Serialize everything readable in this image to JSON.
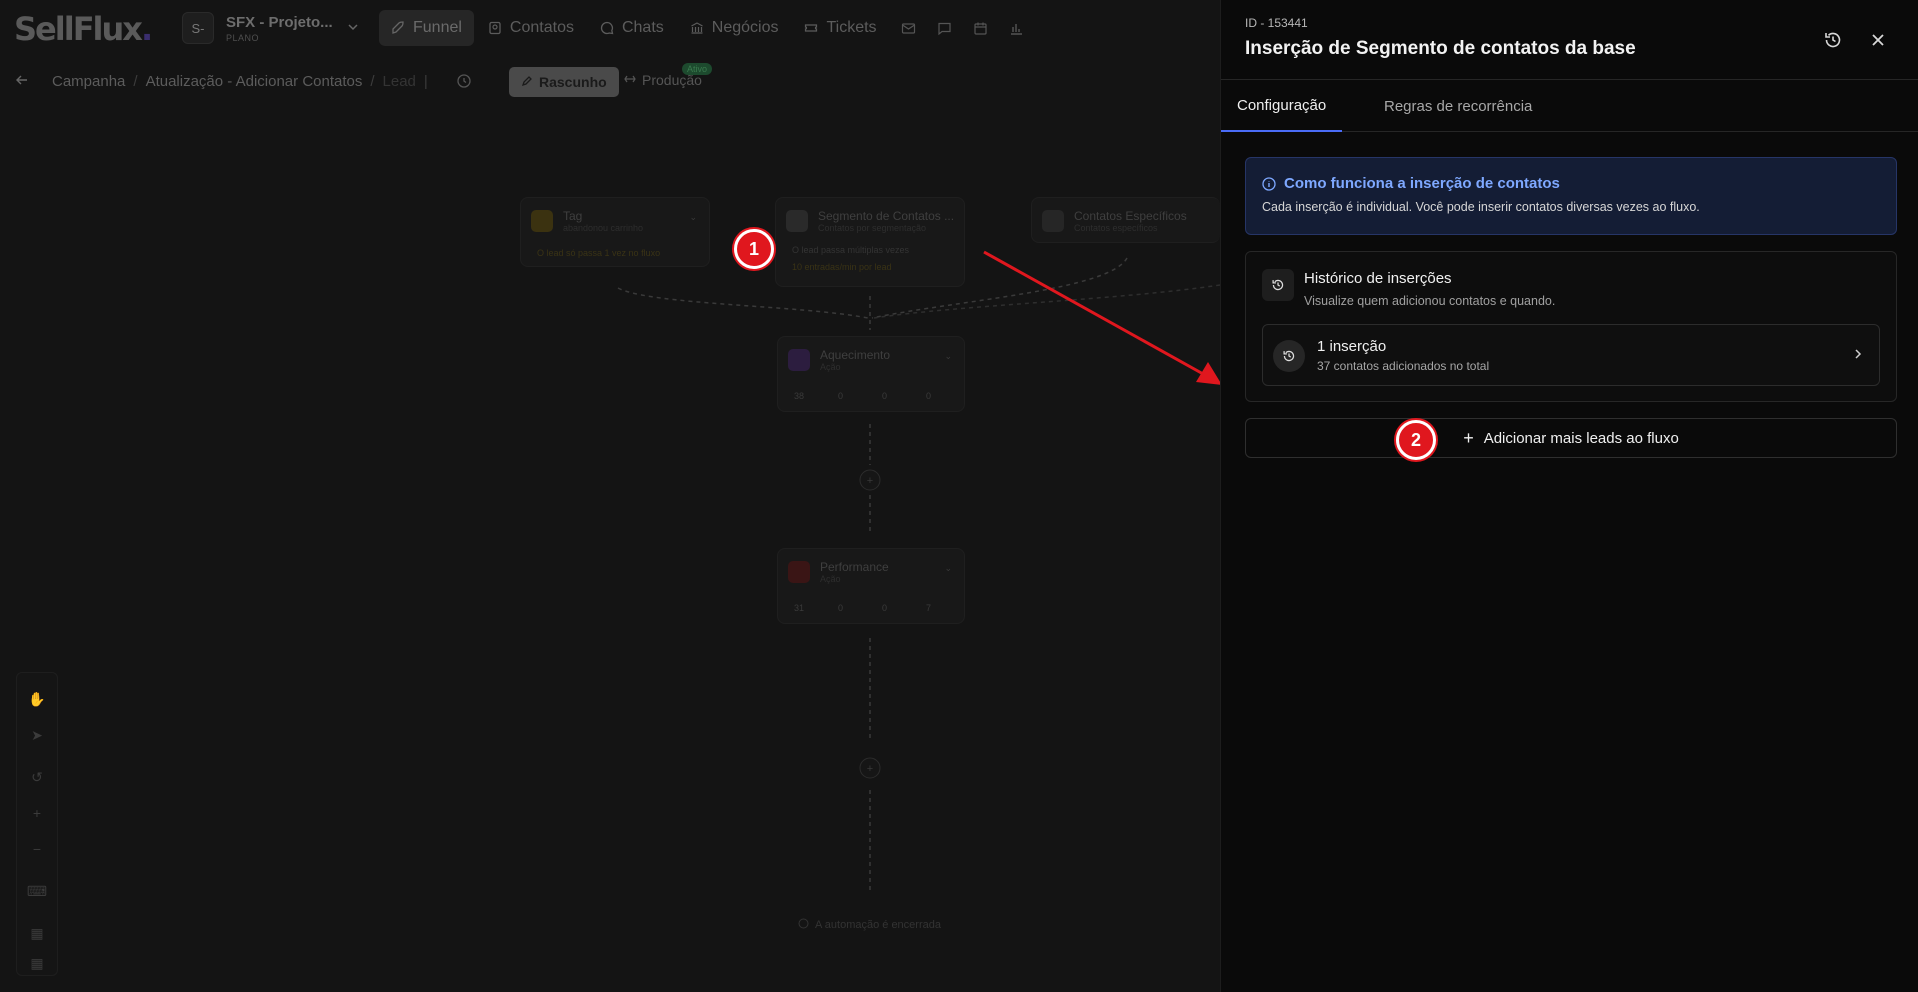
{
  "app": {
    "logo_text": "SellFlux",
    "project": {
      "avatar": "S-",
      "name": "SFX - Projeto...",
      "plan": "PLANO"
    }
  },
  "nav": {
    "items": [
      {
        "label": "Funnel",
        "icon": "rocket-icon",
        "active": true
      },
      {
        "label": "Contatos",
        "icon": "contacts-icon"
      },
      {
        "label": "Chats",
        "icon": "chat-bubble-icon"
      },
      {
        "label": "Negócios",
        "icon": "bank-icon"
      },
      {
        "label": "Tickets",
        "icon": "ticket-icon"
      }
    ],
    "icon_buttons": [
      "mail-icon",
      "message-square-icon",
      "calendar-icon",
      "bar-chart-icon"
    ]
  },
  "breadcrumb": {
    "items": [
      "Campanha",
      "Atualização - Adicionar Contatos",
      "Lead"
    ],
    "draft_label": "Rascunho",
    "production_label": "Produção",
    "active_badge": "Ativo"
  },
  "canvas": {
    "nodes": {
      "tag": {
        "title": "Tag",
        "subtitle": "abandonou carrinho",
        "line1": "O lead só passa 1 vez no fluxo"
      },
      "segment": {
        "title": "Segmento de Contatos ...",
        "subtitle": "Contatos por segmentação",
        "line1": "O lead passa múltiplas vezes",
        "line2": "10 entradas/min por lead"
      },
      "specific": {
        "title": "Contatos Específicos",
        "subtitle": "Contatos específicos"
      },
      "warmup": {
        "title": "Aquecimento",
        "subtitle": "Ação",
        "stats": [
          "38",
          "0",
          "0",
          "0"
        ]
      },
      "performance": {
        "title": "Performance",
        "subtitle": "Ação",
        "stats": [
          "31",
          "0",
          "0",
          "7"
        ]
      }
    },
    "end_label": "A automação é encerrada",
    "annotations": {
      "first": "1",
      "second": "2"
    }
  },
  "panel": {
    "id_label": "ID - 153441",
    "title": "Inserção de Segmento de contatos da base",
    "tabs": [
      {
        "label": "Configuração",
        "active": true
      },
      {
        "label": "Regras de recorrência",
        "active": false
      }
    ],
    "info": {
      "title": "Como funciona a inserção de contatos",
      "text": "Cada inserção é individual. Você pode inserir contatos diversas vezes ao fluxo."
    },
    "history": {
      "title": "Histórico de inserções",
      "subtitle": "Visualize quem adicionou contatos e quando.",
      "entry_title": "1 inserção",
      "entry_subtitle": "37 contatos adicionados no total"
    },
    "add_button": "Adicionar mais leads ao fluxo"
  },
  "colors": {
    "accent_blue": "#4a6cf7",
    "info_title": "#7ea8ff",
    "annotation_red": "#e0171e"
  }
}
